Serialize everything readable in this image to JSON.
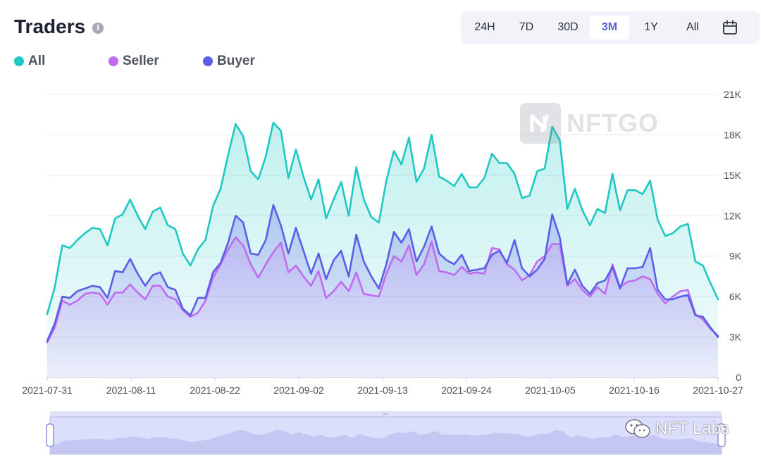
{
  "header": {
    "title": "Traders",
    "info_icon": "info-icon",
    "ranges": [
      "24H",
      "7D",
      "30D",
      "3M",
      "1Y",
      "All"
    ],
    "active_range": "3M",
    "calendar_icon": "calendar-icon"
  },
  "colors": {
    "all": "#1ec9c4",
    "seller": "#c06bf0",
    "buyer": "#5a5ee8",
    "grid": "#e8e9f0",
    "axis_text": "#4b4e5c",
    "active_range": "#5b5fe0"
  },
  "watermark": {
    "text": "NFTGO"
  },
  "overlay_mark": {
    "text": "NFT Labs",
    "icon": "wechat-icon"
  },
  "chart_data": {
    "type": "area",
    "x_ticks": [
      "2021-07-31",
      "2021-08-11",
      "2021-08-22",
      "2021-09-02",
      "2021-09-13",
      "2021-09-24",
      "2021-10-05",
      "2021-10-16",
      "2021-10-27"
    ],
    "y_ticks": [
      "0",
      "3K",
      "6K",
      "9K",
      "12K",
      "15K",
      "18K",
      "21K"
    ],
    "ylim": [
      0,
      21000
    ],
    "grid": true,
    "y_axis_side": "right",
    "legend_position": "top-left",
    "x_start": "2021-07-31",
    "x_end": "2021-10-27",
    "series": [
      {
        "name": "All",
        "values": [
          4700,
          6700,
          9800,
          9600,
          10200,
          10700,
          11100,
          11000,
          9800,
          11800,
          12100,
          13200,
          12000,
          11000,
          12300,
          12600,
          11300,
          11000,
          9200,
          8300,
          9500,
          10200,
          12700,
          14000,
          16500,
          18800,
          17900,
          15300,
          14700,
          16400,
          18900,
          18300,
          14800,
          16900,
          14900,
          13200,
          14700,
          11800,
          13200,
          14500,
          12000,
          15600,
          13200,
          11900,
          11500,
          14600,
          16800,
          15800,
          17800,
          14500,
          15500,
          18000,
          14900,
          14600,
          14200,
          15100,
          14100,
          14100,
          14800,
          16600,
          15900,
          15900,
          15100,
          13300,
          13500,
          15300,
          15500,
          18600,
          17600,
          12500,
          14000,
          12400,
          11300,
          12500,
          12200,
          15100,
          12400,
          13900,
          13900,
          13600,
          14600,
          11700,
          10500,
          10700,
          11200,
          11400,
          8600,
          8300,
          7000,
          5800
        ]
      },
      {
        "name": "Seller",
        "values": [
          2600,
          3700,
          5700,
          5400,
          5700,
          6200,
          6300,
          6200,
          5400,
          6300,
          6300,
          6900,
          6300,
          5800,
          6800,
          6800,
          6000,
          5800,
          5000,
          4500,
          4800,
          5700,
          7400,
          8400,
          9500,
          10400,
          9800,
          8400,
          7400,
          8400,
          9300,
          10000,
          7800,
          8300,
          7500,
          6800,
          7900,
          5900,
          6400,
          7100,
          6400,
          7800,
          6200,
          6100,
          6000,
          7700,
          9000,
          8600,
          9800,
          7600,
          8400,
          10100,
          7900,
          7800,
          7600,
          8200,
          7700,
          7800,
          7700,
          9600,
          9500,
          8400,
          8000,
          7200,
          7600,
          8600,
          9000,
          9900,
          9900,
          6800,
          7300,
          6500,
          6000,
          6700,
          6200,
          8400,
          6700,
          7100,
          7200,
          7500,
          7300,
          6200,
          5500,
          6000,
          6400,
          6500,
          4700,
          4300,
          3600,
          3100
        ]
      },
      {
        "name": "Buyer",
        "values": [
          2700,
          4000,
          6000,
          5900,
          6400,
          6600,
          6800,
          6700,
          5900,
          7900,
          7800,
          8800,
          7700,
          6800,
          7600,
          7800,
          6700,
          6500,
          5100,
          4600,
          5900,
          5900,
          7800,
          8500,
          10000,
          12000,
          11500,
          9200,
          9100,
          10200,
          12800,
          11300,
          9200,
          11100,
          9400,
          7700,
          9200,
          7300,
          8700,
          9400,
          7500,
          10600,
          8600,
          7500,
          6600,
          8400,
          10800,
          10000,
          11000,
          8600,
          9700,
          11200,
          9200,
          8700,
          8400,
          9100,
          7900,
          8000,
          8100,
          9100,
          9400,
          8500,
          10200,
          8100,
          7500,
          8000,
          8800,
          12100,
          10400,
          6900,
          8000,
          6800,
          6200,
          7000,
          7200,
          8200,
          6600,
          8100,
          8100,
          8200,
          9600,
          6500,
          5800,
          5800,
          6000,
          6100,
          4600,
          4500,
          3700,
          3000
        ]
      }
    ]
  }
}
